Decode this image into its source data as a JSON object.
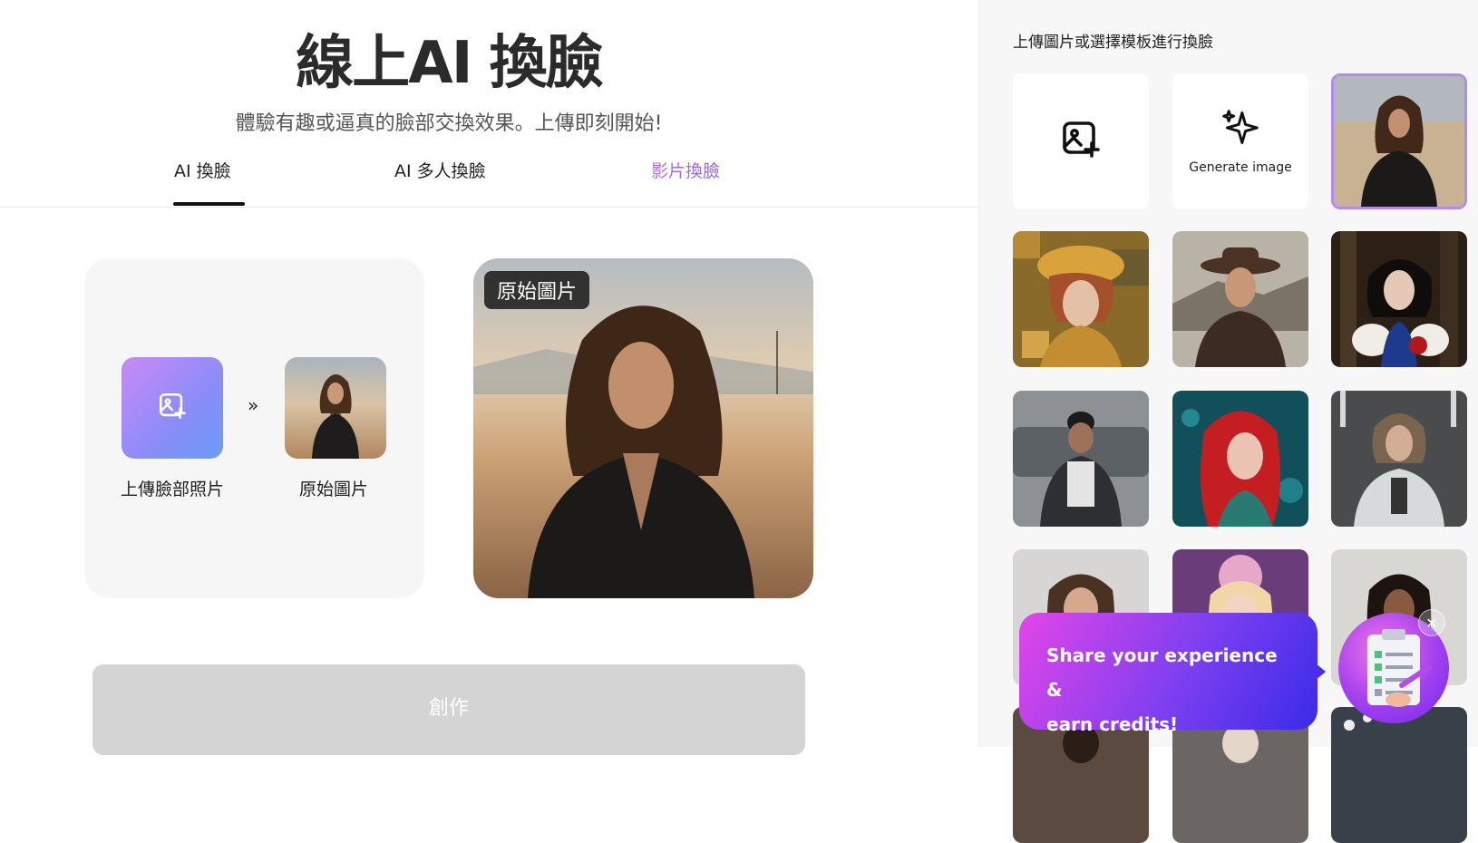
{
  "header": {
    "title": "線上AI 換臉",
    "subtitle": "體驗有趣或逼真的臉部交換效果。上傳即刻開始!"
  },
  "tabs": [
    {
      "label": "AI 換臉",
      "active": true
    },
    {
      "label": "AI 多人換臉",
      "active": false
    },
    {
      "label": "影片換臉",
      "active": false
    }
  ],
  "upload": {
    "upload_face_label": "上傳臉部照片",
    "original_label": "原始圖片",
    "arrow": "»"
  },
  "preview": {
    "badge": "原始圖片"
  },
  "create_button": "創作",
  "sidebar": {
    "heading": "上傳圖片或選擇模板進行換臉",
    "generate_label": "Generate image",
    "templates": [
      {
        "name": "golden-mosaic-woman"
      },
      {
        "name": "cowboy-man"
      },
      {
        "name": "dark-hair-woman-apple"
      },
      {
        "name": "man-with-car"
      },
      {
        "name": "red-hair-woman"
      },
      {
        "name": "space-suit-woman"
      },
      {
        "name": "brunette-woman"
      },
      {
        "name": "fairy-woman"
      },
      {
        "name": "curly-hair-woman"
      }
    ]
  },
  "toast": {
    "line1": "Share your experience &",
    "line2": "earn credits!"
  },
  "colors": {
    "accent_purple": "#b18af3",
    "create_disabled": "#d4d4d4",
    "toast_start": "#e246e8",
    "toast_end": "#3a2be8"
  }
}
